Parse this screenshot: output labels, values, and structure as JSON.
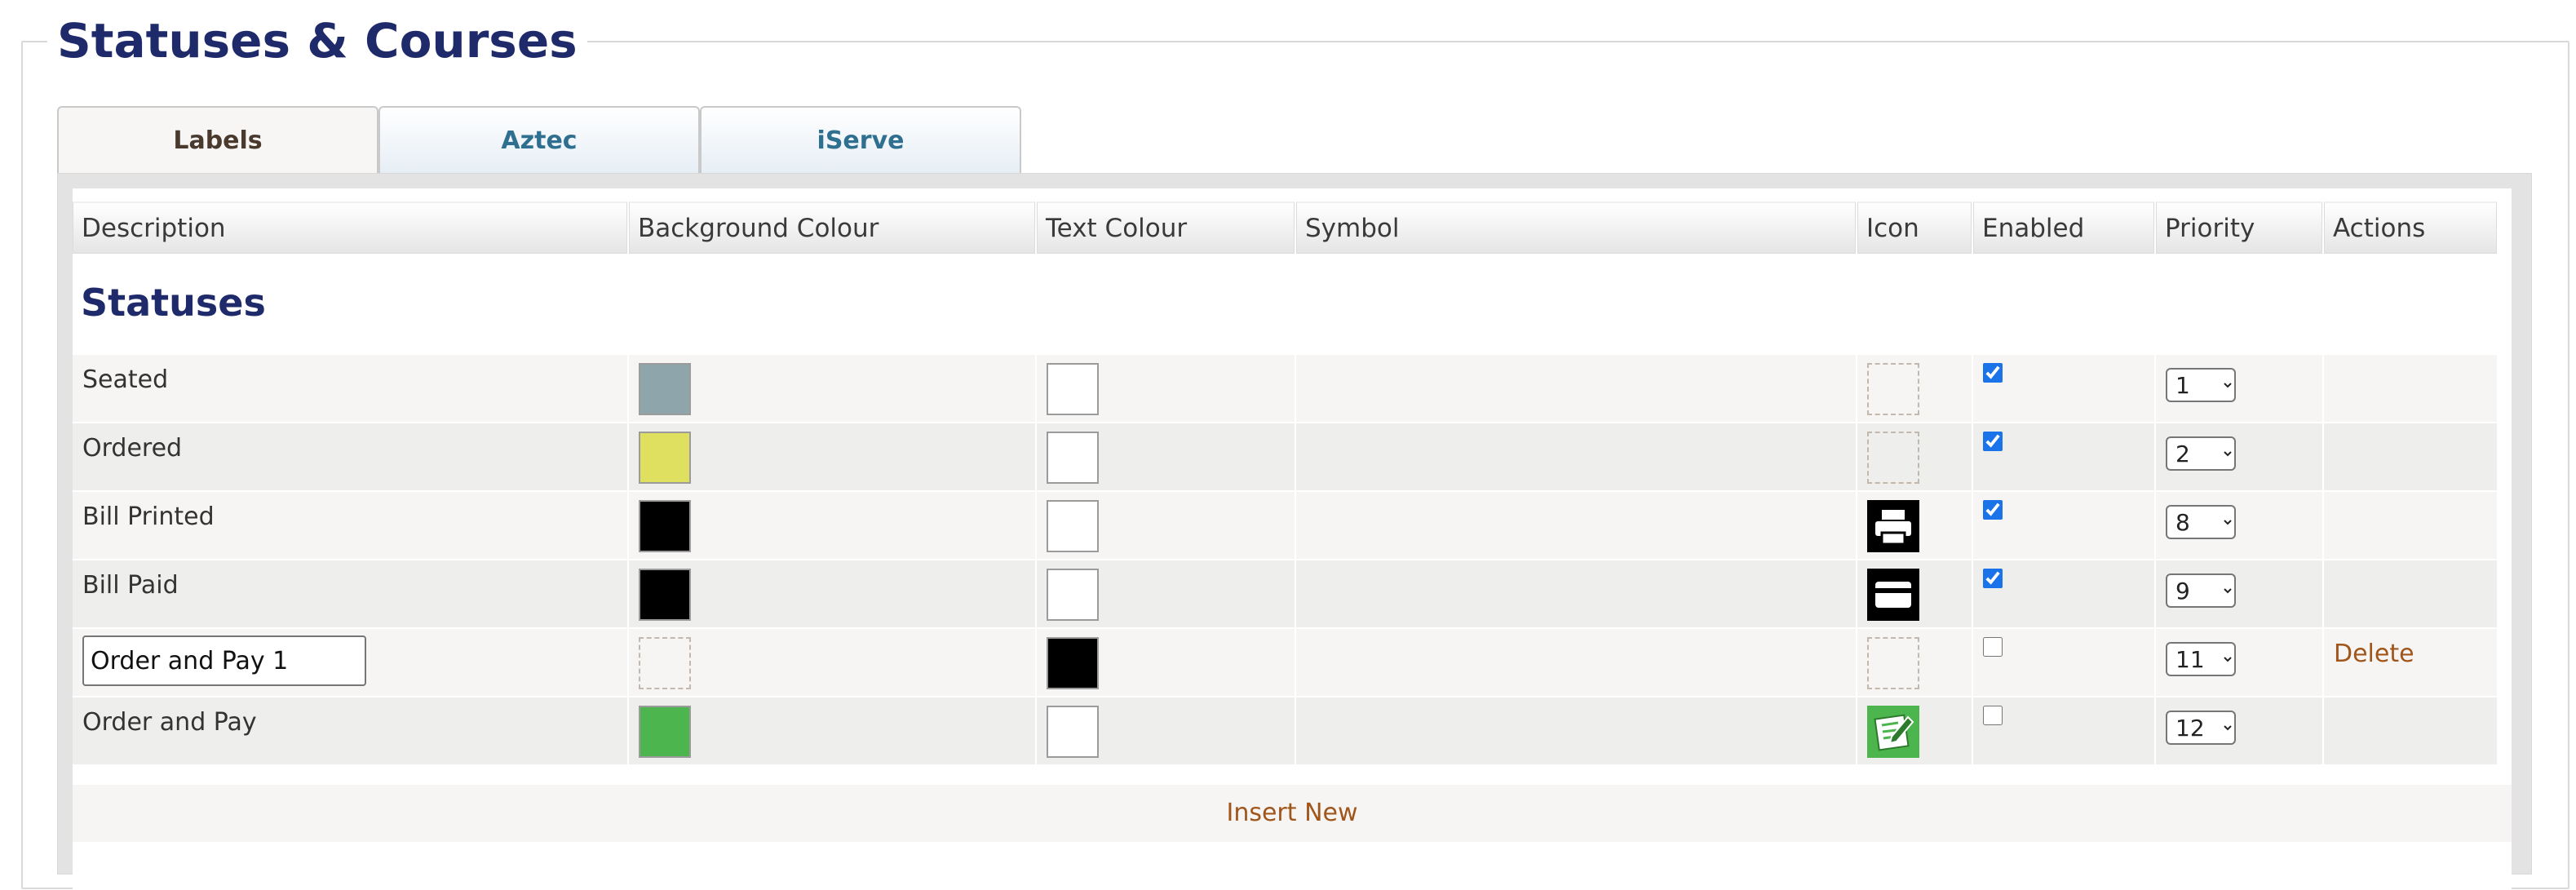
{
  "page": {
    "title": "Statuses & Courses"
  },
  "tabs": [
    {
      "label": "Labels",
      "active": true
    },
    {
      "label": "Aztec",
      "active": false
    },
    {
      "label": "iServe",
      "active": false
    }
  ],
  "table": {
    "headers": {
      "description": "Description",
      "background": "Background Colour",
      "text": "Text Colour",
      "symbol": "Symbol",
      "icon": "Icon",
      "enabled": "Enabled",
      "priority": "Priority",
      "actions": "Actions"
    },
    "section_title": "Statuses",
    "rows": [
      {
        "description": "Seated",
        "bg_color": "#8ea6ab",
        "text_color": "#ffffff",
        "icon": "",
        "enabled": true,
        "priority": "1",
        "action": ""
      },
      {
        "description": "Ordered",
        "bg_color": "#e0e060",
        "text_color": "#ffffff",
        "icon": "",
        "enabled": true,
        "priority": "2",
        "action": ""
      },
      {
        "description": "Bill Printed",
        "bg_color": "#000000",
        "text_color": "#ffffff",
        "icon": "printer-icon",
        "enabled": true,
        "priority": "8",
        "action": ""
      },
      {
        "description": "Bill Paid",
        "bg_color": "#000000",
        "text_color": "#ffffff",
        "icon": "credit-card-icon",
        "enabled": true,
        "priority": "9",
        "action": ""
      },
      {
        "description": "Order and Pay 1",
        "editable": true,
        "bg_color": "",
        "text_color": "#000000",
        "icon": "",
        "enabled": false,
        "priority": "11",
        "action": "Delete"
      },
      {
        "description": "Order and Pay",
        "bg_color": "#4db54d",
        "text_color": "#ffffff",
        "icon": "edit-order-icon",
        "enabled": false,
        "priority": "12",
        "action": ""
      }
    ],
    "insert_label": "Insert New"
  },
  "colors": {
    "title": "#1f2a6b",
    "tab_text": "#2f6f8f",
    "link": "#a0561b",
    "checkbox": "#1a73e8"
  }
}
